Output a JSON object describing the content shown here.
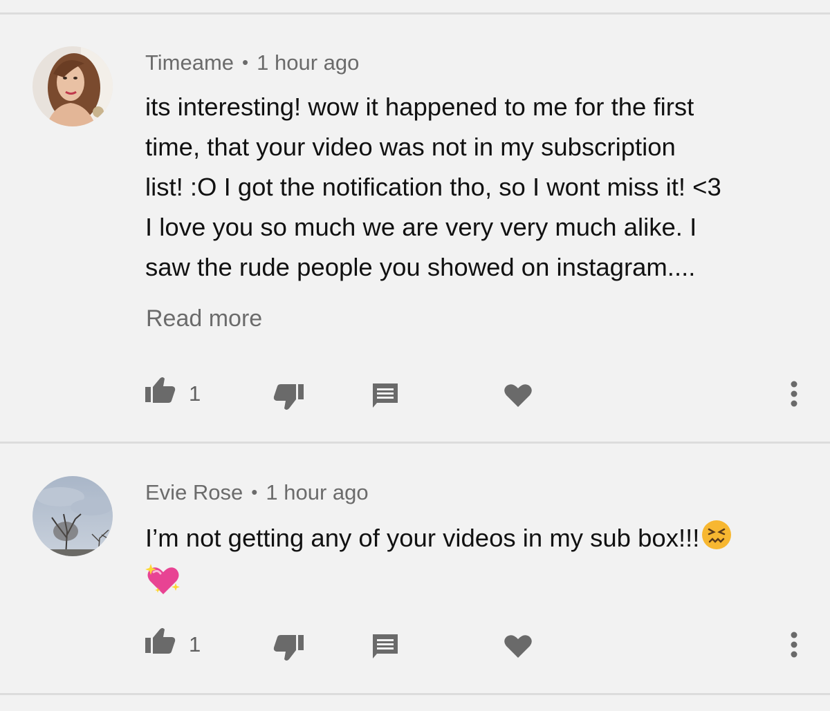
{
  "comments": [
    {
      "author": "Timeame",
      "separator": "•",
      "time": "1 hour ago",
      "lines": [
        "its interesting! wow it happened to me for the first",
        "time, that your video was not in my subscription",
        "list! :O I got the notification tho, so I wont miss it! <3",
        "I love you so much we are very very much alike. I",
        "saw the rude people you showed on instagram...."
      ],
      "read_more": "Read more",
      "like_count": "1",
      "icons": [
        "thumbs-up-icon",
        "thumbs-down-icon",
        "reply-icon",
        "heart-icon",
        "more-vert-icon"
      ]
    },
    {
      "author": "Evie Rose",
      "separator": "•",
      "time": "1 hour ago",
      "lines": [
        "I’m not getting any of your videos in my sub box!!!"
      ],
      "emojis": [
        "confounded-face-emoji",
        "sparkling-heart-emoji"
      ],
      "like_count": "1",
      "icons": [
        "thumbs-up-icon",
        "thumbs-down-icon",
        "reply-icon",
        "heart-icon",
        "more-vert-icon"
      ]
    }
  ],
  "colors": {
    "background": "#f2f2f2",
    "divider": "#dcdcdc",
    "meta_text": "#6b6b6b",
    "body_text": "#111111",
    "icon": "#6a6a6a"
  }
}
